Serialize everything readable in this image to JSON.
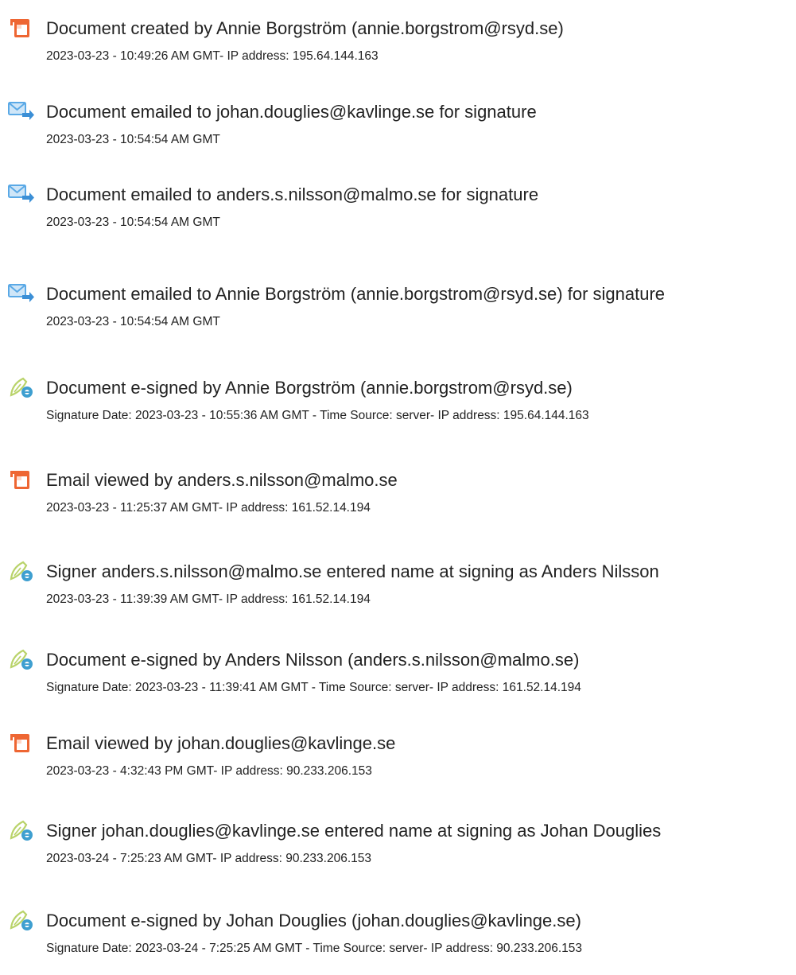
{
  "events": [
    {
      "icon": "document-created-icon",
      "title": "Document created by Annie Borgström (annie.borgstrom@rsyd.se)",
      "detail": "2023-03-23 - 10:49:26 AM GMT- IP address: 195.64.144.163"
    },
    {
      "icon": "email-sent-icon",
      "title": "Document emailed to johan.douglies@kavlinge.se for signature",
      "detail": "2023-03-23 - 10:54:54 AM GMT"
    },
    {
      "icon": "email-sent-icon",
      "title": "Document emailed to anders.s.nilsson@malmo.se for signature",
      "detail": "2023-03-23 - 10:54:54 AM GMT"
    },
    {
      "icon": "email-sent-icon",
      "title": "Document emailed to Annie Borgström (annie.borgstrom@rsyd.se) for signature",
      "detail": "2023-03-23 - 10:54:54 AM GMT"
    },
    {
      "icon": "e-sign-icon",
      "title": "Document e-signed by Annie Borgström (annie.borgstrom@rsyd.se)",
      "detail": "Signature Date: 2023-03-23 - 10:55:36 AM GMT - Time Source: server- IP address: 195.64.144.163"
    },
    {
      "icon": "email-viewed-icon",
      "title": "Email viewed by anders.s.nilsson@malmo.se",
      "detail": "2023-03-23 - 11:25:37 AM GMT- IP address: 161.52.14.194"
    },
    {
      "icon": "e-sign-icon",
      "title": "Signer anders.s.nilsson@malmo.se entered name at signing as Anders Nilsson",
      "detail": "2023-03-23 - 11:39:39 AM GMT- IP address: 161.52.14.194"
    },
    {
      "icon": "e-sign-icon",
      "title": "Document e-signed by Anders Nilsson (anders.s.nilsson@malmo.se)",
      "detail": "Signature Date: 2023-03-23 - 11:39:41 AM GMT - Time Source: server- IP address: 161.52.14.194"
    },
    {
      "icon": "email-viewed-icon",
      "title": "Email viewed by johan.douglies@kavlinge.se",
      "detail": "2023-03-23 - 4:32:43 PM GMT- IP address: 90.233.206.153"
    },
    {
      "icon": "e-sign-icon",
      "title": "Signer johan.douglies@kavlinge.se entered name at signing as Johan Douglies",
      "detail": "2023-03-24 - 7:25:23 AM GMT- IP address: 90.233.206.153"
    },
    {
      "icon": "e-sign-icon",
      "title": "Document e-signed by Johan Douglies (johan.douglies@kavlinge.se)",
      "detail": "Signature Date: 2023-03-24 - 7:25:25 AM GMT - Time Source: server- IP address: 90.233.206.153"
    }
  ],
  "colors": {
    "document_icon": "#ee6633",
    "email_icon": "#5aa9e6",
    "sign_pen": "#b9d36a",
    "sign_badge": "#3e9fd0",
    "text": "#222222"
  }
}
